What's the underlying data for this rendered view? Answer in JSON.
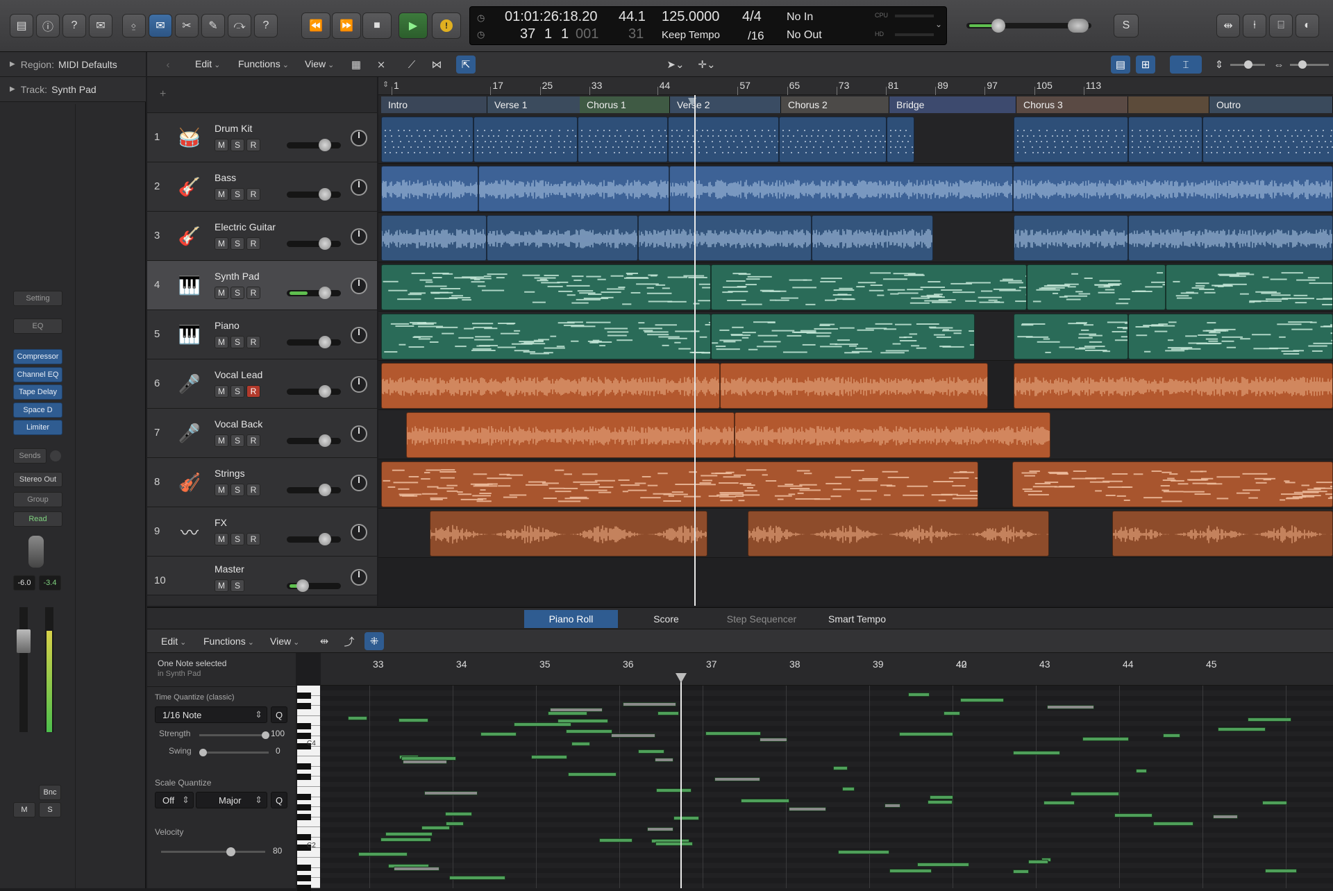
{
  "control_bar": {
    "lcd": {
      "time": "01:01:26:18.20",
      "bars": [
        "37",
        "1",
        "1"
      ],
      "bars_dim": "001",
      "beat_sub": "31",
      "sample_rate": "44.1",
      "tempo": "125.0000",
      "tempo_mode": "Keep Tempo",
      "signature_top": "4/4",
      "signature_bottom": "/16",
      "midi_in": "No In",
      "midi_out": "No Out",
      "cpu_label": "CPU",
      "hd_label": "HD"
    },
    "s_button": "S"
  },
  "inspector": {
    "region_label": "Region:",
    "region_value": "MIDI Defaults",
    "track_label": "Track:",
    "track_value": "Synth Pad",
    "setting": "Setting",
    "eq": "EQ",
    "plugins": [
      "Compressor",
      "Channel EQ",
      "Tape Delay",
      "Space D",
      "Limiter"
    ],
    "sends": "Sends",
    "output": "Stereo Out",
    "group": "Group",
    "automation": "Read",
    "volume": "-6.0",
    "peak": "-3.4",
    "bnc": "Bnc",
    "mute": "M",
    "solo": "S"
  },
  "track_toolbar": {
    "edit": "Edit",
    "functions": "Functions",
    "view": "View"
  },
  "ruler": {
    "bars": [
      "1",
      "17",
      "25",
      "33",
      "44",
      "57",
      "65",
      "73",
      "81",
      "89",
      "97",
      "105",
      "113"
    ]
  },
  "markers": [
    "Intro",
    "Verse 1",
    "Chorus 1",
    "Verse 2",
    "Chorus 2",
    "Bridge",
    "Chorus 3",
    "Outro"
  ],
  "tracks": [
    {
      "num": "1",
      "name": "Drum Kit",
      "icon": "drum-kit-icon",
      "glyph": "🥁",
      "rec": false
    },
    {
      "num": "2",
      "name": "Bass",
      "icon": "bass-guitar-icon",
      "glyph": "🎸",
      "rec": false
    },
    {
      "num": "3",
      "name": "Electric Guitar",
      "icon": "electric-guitar-icon",
      "glyph": "🎸",
      "rec": false
    },
    {
      "num": "4",
      "name": "Synth Pad",
      "icon": "keyboard-icon",
      "glyph": "🎹",
      "rec": false
    },
    {
      "num": "5",
      "name": "Piano",
      "icon": "piano-icon",
      "glyph": "🎹",
      "rec": false
    },
    {
      "num": "6",
      "name": "Vocal Lead",
      "icon": "microphone-icon",
      "glyph": "🎤",
      "rec": true
    },
    {
      "num": "7",
      "name": "Vocal Back",
      "icon": "microphone-icon",
      "glyph": "🎤",
      "rec": false
    },
    {
      "num": "8",
      "name": "Strings",
      "icon": "violin-icon",
      "glyph": "🎻",
      "rec": false
    },
    {
      "num": "9",
      "name": "FX",
      "icon": "waveform-icon",
      "glyph": "〰",
      "rec": false
    },
    {
      "num": "10",
      "name": "Master",
      "icon": "",
      "glyph": "",
      "rec": false
    }
  ],
  "msr": {
    "m": "M",
    "s": "S",
    "r": "R"
  },
  "editor_tabs": [
    "Piano Roll",
    "Score",
    "Step Sequencer",
    "Smart Tempo"
  ],
  "editor_toolbar": {
    "edit": "Edit",
    "functions": "Functions",
    "view": "View"
  },
  "piano_roll": {
    "selection_line1": "One Note selected",
    "selection_line2": "in Synth Pad",
    "time_quantize_label": "Time Quantize (classic)",
    "quantize_value": "1/16 Note",
    "q": "Q",
    "strength_label": "Strength",
    "strength_value": "100",
    "swing_label": "Swing",
    "swing_value": "0",
    "scale_quantize_label": "Scale Quantize",
    "scale_off": "Off",
    "scale_mode": "Major",
    "velocity_label": "Velocity",
    "velocity_value": "80",
    "key_c4": "C4",
    "key_c2": "C2",
    "ruler_bars": [
      "33",
      "34",
      "35",
      "36",
      "37",
      "38",
      "39",
      "40",
      "42",
      "43",
      "44",
      "45"
    ]
  },
  "colors": {
    "drums": "#2e4f78",
    "bass": "#3d6296",
    "guitar": "#34557d",
    "synth": "#2a6b58",
    "vocal": "#b3582e",
    "strings": "#a8552e",
    "fx": "#8e4c2b",
    "accent": "#2f5c91",
    "note": "#4fa05a"
  }
}
